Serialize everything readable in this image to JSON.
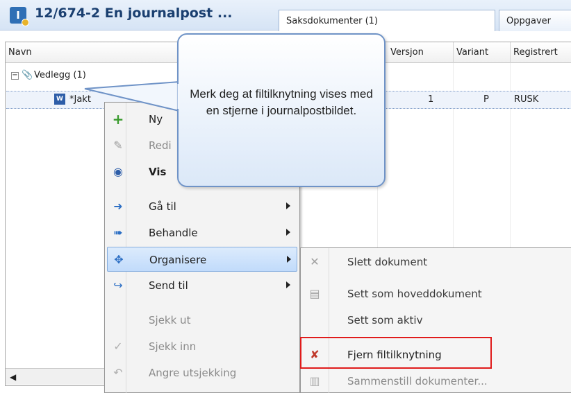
{
  "window": {
    "title": "12/674-2  En journalpost ...",
    "tabs": [
      {
        "label": "Saksdokumenter (1)",
        "active": true
      },
      {
        "label": "Oppgaver",
        "active": false
      }
    ]
  },
  "grid": {
    "columns": [
      "Navn",
      "Versjon",
      "Variant",
      "Registrert"
    ],
    "folder": {
      "label": "Vedlegg (1)"
    },
    "row": {
      "name": "*Jakt",
      "version": "1",
      "variant": "P",
      "registered": "RUSK"
    }
  },
  "context_menu": {
    "items": [
      {
        "label": "Ny",
        "icon": "plus-icon",
        "disabled": false
      },
      {
        "label": "Redi",
        "icon": "pencil-icon",
        "disabled": true
      },
      {
        "label": "Vis",
        "icon": "eye-icon",
        "disabled": false,
        "bold": true
      },
      {
        "label": "Gå til",
        "icon": "goto-arrow-icon",
        "submenu": true
      },
      {
        "label": "Behandle",
        "icon": "process-icon",
        "submenu": true
      },
      {
        "label": "Organisere",
        "icon": "organize-icon",
        "submenu": true,
        "highlighted": true
      },
      {
        "label": "Send til",
        "icon": "send-icon",
        "submenu": true
      },
      {
        "label": "Sjekk ut",
        "icon": "",
        "disabled": true
      },
      {
        "label": "Sjekk inn",
        "icon": "check-icon",
        "disabled": true
      },
      {
        "label": "Angre utsjekking",
        "icon": "undo-icon",
        "disabled": true
      }
    ]
  },
  "submenu": {
    "items": [
      {
        "label": "Slett dokument",
        "icon": "delete-x-icon"
      },
      {
        "label": "Sett som hoveddokument",
        "icon": "main-document-icon"
      },
      {
        "label": "Sett som aktiv",
        "icon": ""
      },
      {
        "label": "Fjern filtilknytning",
        "icon": "remove-file-link-icon",
        "emphasized": true
      },
      {
        "label": "Sammenstill dokumenter...",
        "icon": "merge-icon",
        "disabled": true
      }
    ]
  },
  "callout": {
    "text": "Merk deg at filtilknytning vises med en stjerne i journalpostbildet."
  },
  "colors": {
    "highlight": "#c1dbfb",
    "emphasis_box": "#e01b1b",
    "title": "#1a3f70"
  }
}
